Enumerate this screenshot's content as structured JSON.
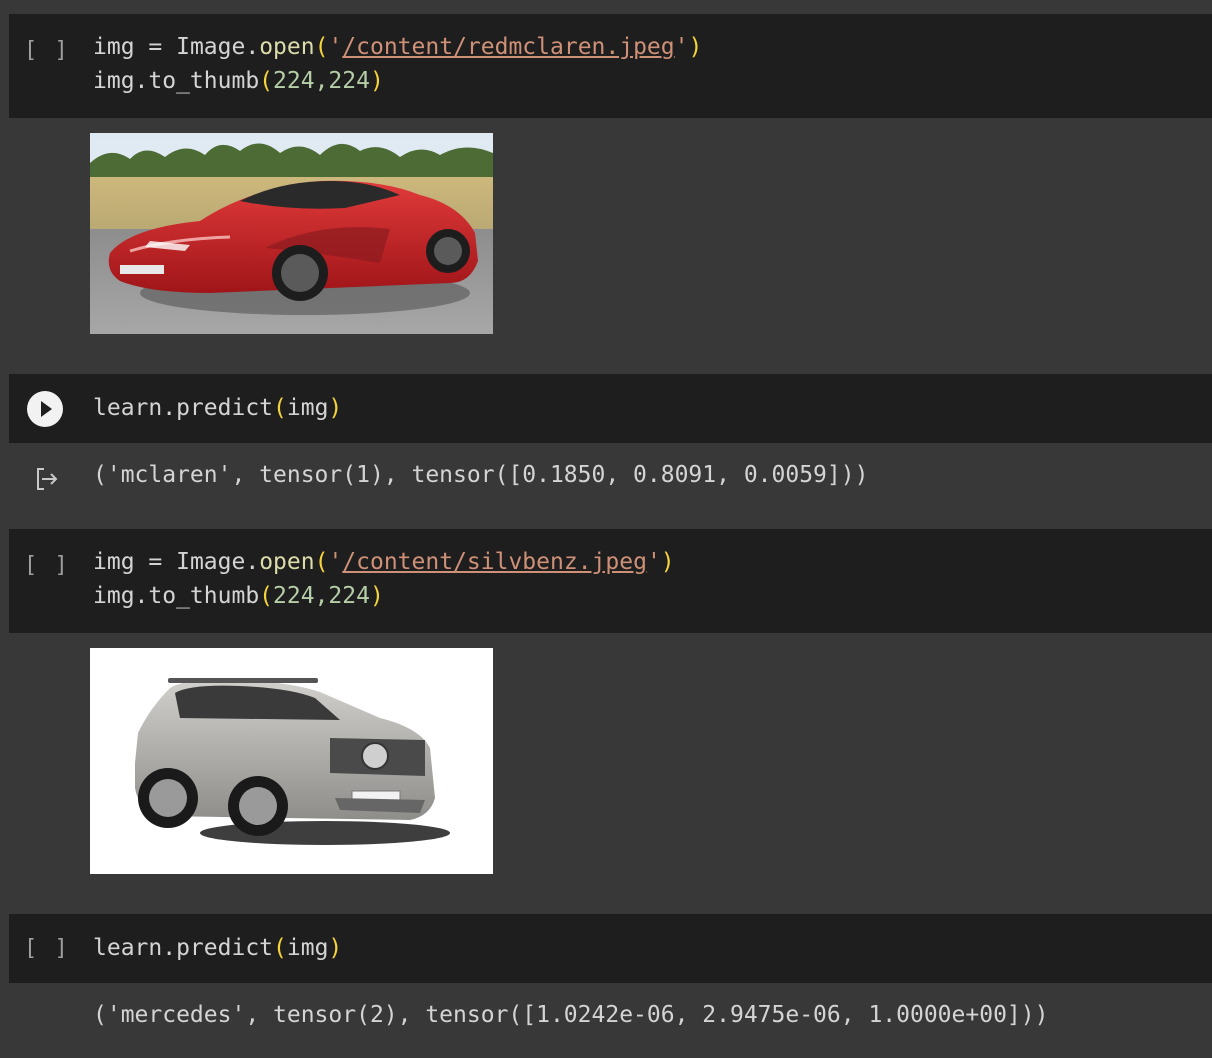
{
  "cells": [
    {
      "bracket": "[ ]",
      "line1": {
        "var": "img",
        "op": " = ",
        "obj": "Image.",
        "fn": "open",
        "q1": "'",
        "path": "/content/redmclaren.jpeg",
        "q2": "'"
      },
      "line2": {
        "pre": "img.to_thumb",
        "args": "224,224"
      }
    },
    {
      "call": {
        "pre": "learn.predict",
        "arg": "img"
      },
      "output": "('mclaren', tensor(1), tensor([0.1850, 0.8091, 0.0059]))"
    },
    {
      "bracket": "[ ]",
      "line1": {
        "var": "img",
        "op": " = ",
        "obj": "Image.",
        "fn": "open",
        "q1": "'",
        "path": "/content/silvbenz.jpeg",
        "q2": "'"
      },
      "line2": {
        "pre": "img.to_thumb",
        "args": "224,224"
      }
    },
    {
      "bracket": "[ ]",
      "call": {
        "pre": "learn.predict",
        "arg": "img"
      },
      "output": "('mercedes', tensor(2), tensor([1.0242e-06, 2.9475e-06, 1.0000e+00]))"
    }
  ],
  "paren_open": "(",
  "paren_close": ")",
  "icons": {
    "run": "play-icon",
    "output": "output-arrow-icon"
  },
  "colors": {
    "cell_bg": "#1e1e1e",
    "page_bg": "#383838",
    "paren": "#f5d33b",
    "string": "#ce9178",
    "number": "#b5cea8",
    "function": "#dcdcaa"
  }
}
